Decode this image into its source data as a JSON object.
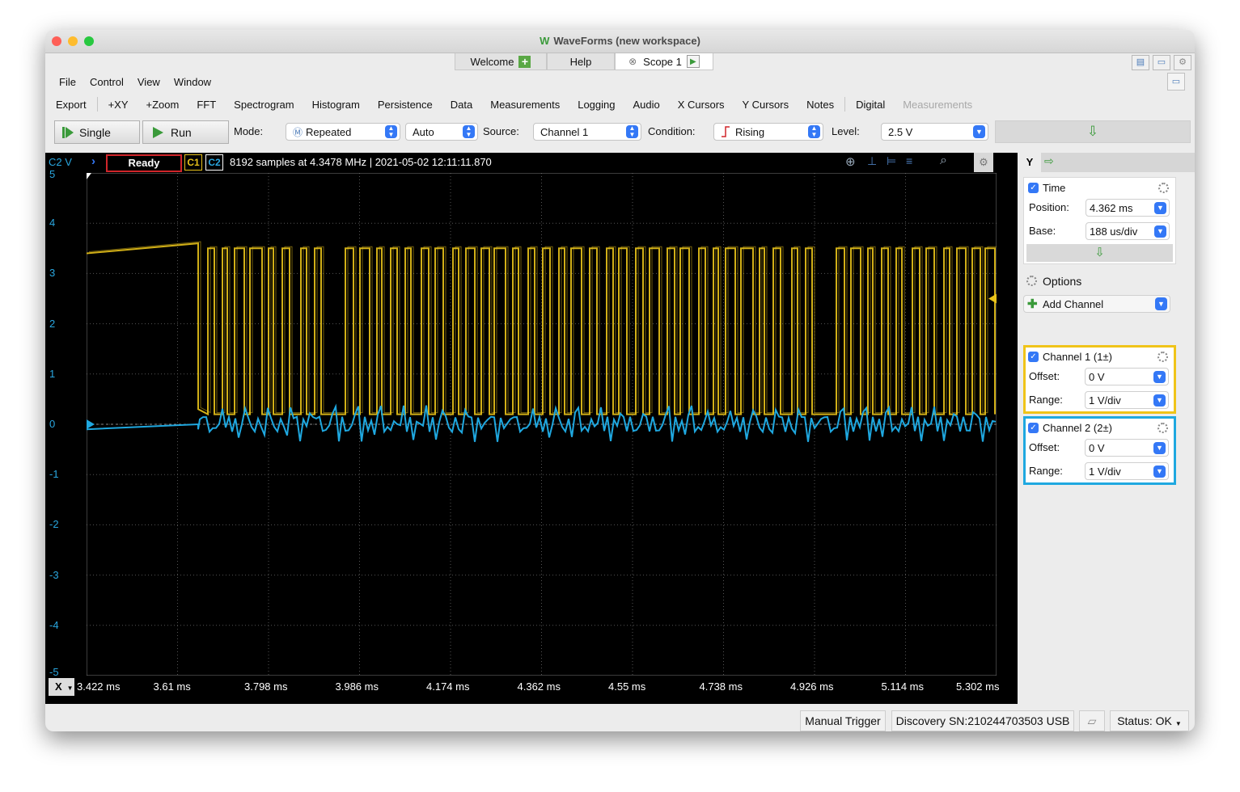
{
  "window": {
    "title": "WaveForms (new workspace)",
    "logo": "W"
  },
  "tabs": [
    {
      "label": "Welcome"
    },
    {
      "label": "Help"
    },
    {
      "label": "Scope 1"
    }
  ],
  "menu": [
    "File",
    "Control",
    "View",
    "Window"
  ],
  "toolbar": {
    "export": "Export",
    "items": [
      "+XY",
      "+Zoom",
      "FFT",
      "Spectrogram",
      "Histogram",
      "Persistence",
      "Data",
      "Measurements",
      "Logging",
      "Audio",
      "X Cursors",
      "Y Cursors",
      "Notes"
    ],
    "digital": "Digital",
    "measurements_dim": "Measurements"
  },
  "controls": {
    "single": "Single",
    "run": "Run",
    "mode_label": "Mode:",
    "mode_value": "Repeated",
    "auto_value": "Auto",
    "source_label": "Source:",
    "source_value": "Channel 1",
    "condition_label": "Condition:",
    "condition_value": "Rising",
    "level_label": "Level:",
    "level_value": "2.5 V"
  },
  "scope": {
    "y_unit": "C2 V",
    "status": "Ready",
    "c1": "C1",
    "c2": "C2",
    "info": "8192 samples at 4.3478 MHz | 2021-05-02 12:11:11.870",
    "x_button": "X",
    "y_ticks": [
      "5",
      "4",
      "3",
      "2",
      "1",
      "0",
      "-1",
      "-2",
      "-3",
      "-4",
      "-5"
    ],
    "x_ticks": [
      "3.422 ms",
      "3.61 ms",
      "3.798 ms",
      "3.986 ms",
      "4.174 ms",
      "4.362 ms",
      "4.55 ms",
      "4.738 ms",
      "4.926 ms",
      "5.114 ms",
      "5.302 ms"
    ],
    "colors": {
      "c1": "#e8c21a",
      "c2": "#1fa8e0",
      "ready_border": "#d0252a"
    }
  },
  "panel": {
    "tab_y": "Y",
    "time_title": "Time",
    "position_label": "Position:",
    "position_value": "4.362 ms",
    "base_label": "Base:",
    "base_value": "188 us/div",
    "options": "Options",
    "add_channel": "Add Channel",
    "ch1_title": "Channel 1 (1±)",
    "ch2_title": "Channel 2 (2±)",
    "offset_label": "Offset:",
    "offset_value": "0 V",
    "range_label": "Range:",
    "range_value": "1 V/div"
  },
  "status": {
    "manual_trigger": "Manual Trigger",
    "device": "Discovery SN:210244703503 USB",
    "state": "Status: OK"
  }
}
